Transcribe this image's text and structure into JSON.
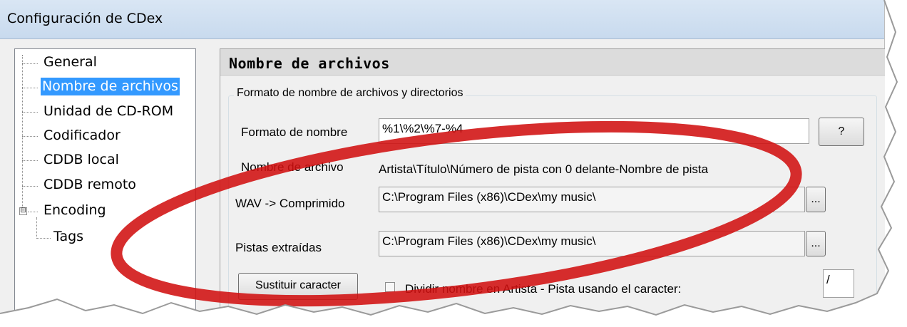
{
  "window": {
    "title": "Configuración de CDex"
  },
  "tree": {
    "items": [
      {
        "label": "General",
        "selected": false
      },
      {
        "label": "Nombre de archivos",
        "selected": true
      },
      {
        "label": "Unidad de CD-ROM",
        "selected": false
      },
      {
        "label": "Codificador",
        "selected": false
      },
      {
        "label": "CDDB local",
        "selected": false
      },
      {
        "label": "CDDB remoto",
        "selected": false
      },
      {
        "label": "Encoding",
        "selected": false,
        "expander": "⊟"
      },
      {
        "label": "Tags",
        "selected": false
      }
    ]
  },
  "panel": {
    "title": "Nombre de archivos",
    "group_title": "Formato de nombre de archivos y directorios",
    "format_label": "Formato de nombre",
    "format_value": "%1\\%2\\%7-%4",
    "help_button": "?",
    "filename_label": "Nombre de archivo",
    "filename_value": "Artista\\Título\\Número de pista con 0 delante-Nombre de pista",
    "wav_label": "WAV -> Comprimido",
    "wav_value": "C:\\Program Files (x86)\\CDex\\my music\\",
    "browse_button": "...",
    "tracks_label": "Pistas extraídas",
    "tracks_value": "C:\\Program Files (x86)\\CDex\\my music\\",
    "replace_button": "Sustituir caracter",
    "split_label": "Dividir nombre en Artista - Pista usando el caracter:",
    "split_checked": false,
    "split_char": "/"
  },
  "colors": {
    "selection": "#3399ff",
    "annotation": "#d01010"
  }
}
